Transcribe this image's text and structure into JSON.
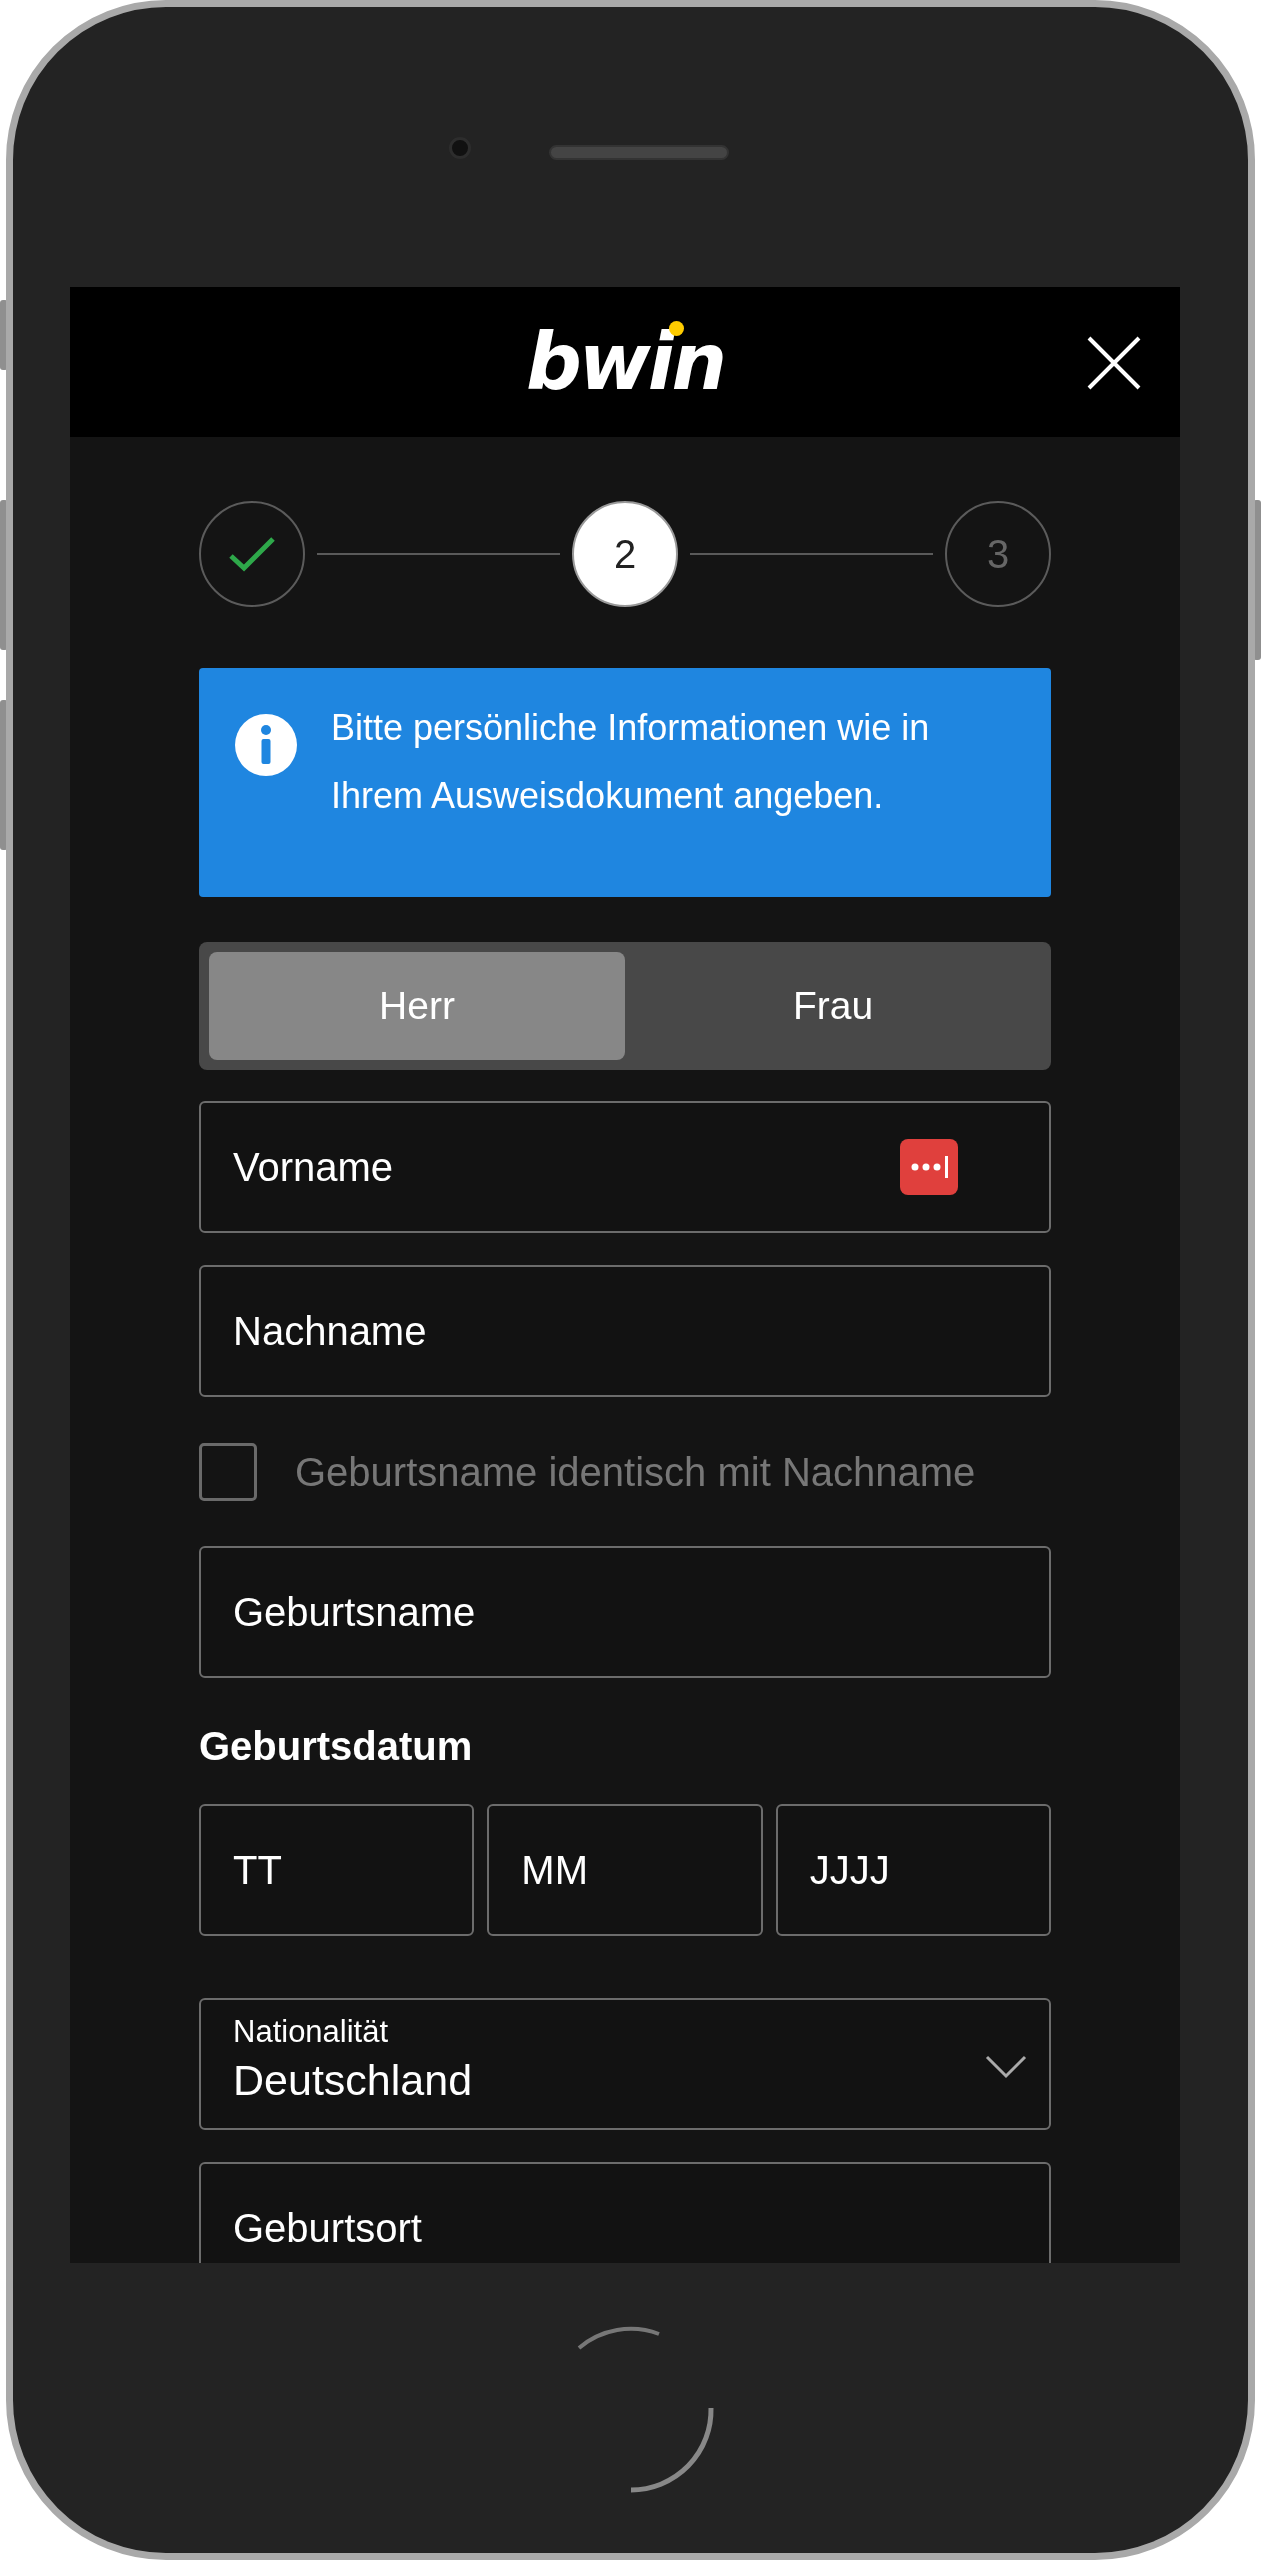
{
  "header": {
    "logo": "bwin"
  },
  "steps": [
    {
      "done": true,
      "current": false
    },
    {
      "label": "2",
      "done": false,
      "current": true
    },
    {
      "label": "3",
      "done": false,
      "current": false
    }
  ],
  "info": {
    "text": "Bitte persönliche Informationen wie in Ihrem Ausweisdokument angeben."
  },
  "salutation": [
    {
      "label": "Herr",
      "selected": true
    },
    {
      "label": "Frau",
      "selected": false
    }
  ],
  "form": [
    {
      "kind": "text",
      "placeholder": "Vorname",
      "autofill_icon": true
    },
    {
      "kind": "text",
      "placeholder": "Nachname"
    },
    {
      "kind": "checkbox",
      "label": "Geburtsname identisch mit Nachname",
      "checked": false
    },
    {
      "kind": "text",
      "placeholder": "Geburtsname"
    },
    {
      "kind": "heading",
      "text": "Geburtsdatum"
    },
    {
      "kind": "date",
      "parts": [
        {
          "placeholder": "TT"
        },
        {
          "placeholder": "MM"
        },
        {
          "placeholder": "JJJJ"
        }
      ]
    },
    {
      "kind": "select",
      "label": "Nationalität",
      "value": "Deutschland"
    },
    {
      "kind": "text",
      "placeholder": "Geburtsort"
    }
  ]
}
